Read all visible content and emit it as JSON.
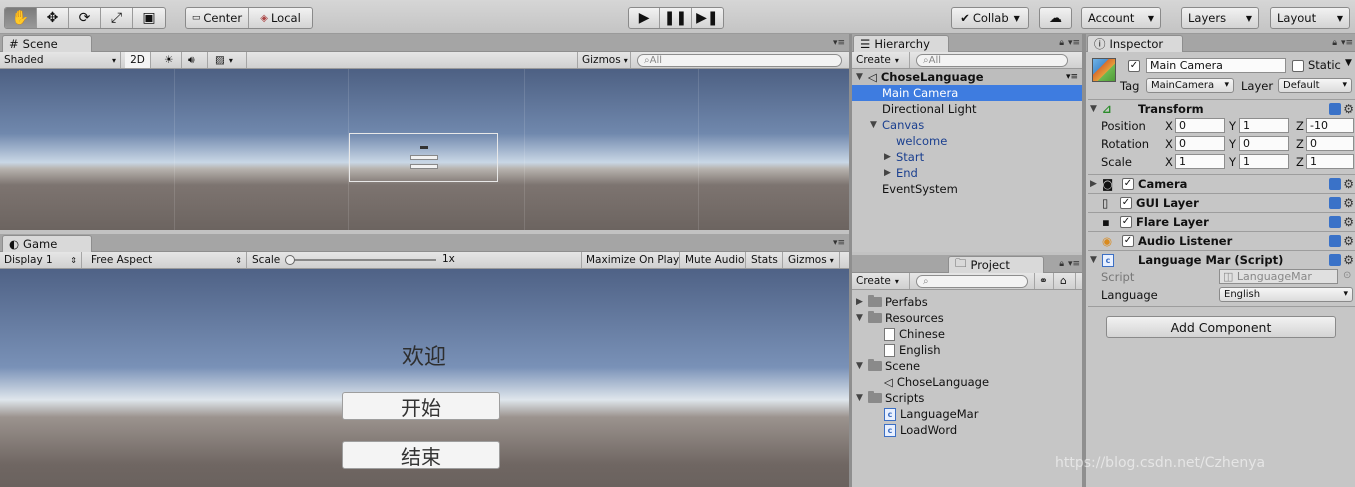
{
  "toolbar": {
    "tools": [
      "hand-icon",
      "move-icon",
      "rotate-icon",
      "scale-icon",
      "rect-icon"
    ],
    "pivot": "Center",
    "space": "Local",
    "collab": "Collab",
    "account": "Account",
    "layers": "Layers",
    "layout": "Layout"
  },
  "scene": {
    "tab": "Scene",
    "shading": "Shaded",
    "mode_2d": "2D",
    "gizmos": "Gizmos",
    "search_placeholder": "All"
  },
  "game": {
    "tab": "Game",
    "display": "Display 1",
    "aspect": "Free Aspect",
    "scale_label": "Scale",
    "scale_value": "1x",
    "maximize": "Maximize On Play",
    "mute": "Mute Audio",
    "stats": "Stats",
    "gizmos": "Gizmos",
    "welcome": "欢迎",
    "start": "开始",
    "end": "结束"
  },
  "hierarchy": {
    "tab": "Hierarchy",
    "create": "Create",
    "search_placeholder": "All",
    "scene_name": "ChoseLanguage",
    "items": [
      "Main Camera",
      "Directional Light",
      "Canvas",
      "welcome",
      "Start",
      "End",
      "EventSystem"
    ]
  },
  "project": {
    "tab": "Project",
    "create": "Create",
    "items": [
      "Perfabs",
      "Resources",
      "Chinese",
      "English",
      "Scene",
      "ChoseLanguage",
      "Scripts",
      "LanguageMar",
      "LoadWord"
    ]
  },
  "inspector": {
    "tab": "Inspector",
    "object_name": "Main Camera",
    "static_label": "Static",
    "tag_label": "Tag",
    "tag_value": "MainCamera",
    "layer_label": "Layer",
    "layer_value": "Default",
    "transform": {
      "title": "Transform",
      "position_label": "Position",
      "position": [
        "0",
        "1",
        "-10"
      ],
      "rotation_label": "Rotation",
      "rotation": [
        "0",
        "0",
        "0"
      ],
      "scale_label": "Scale",
      "scale": [
        "1",
        "1",
        "1"
      ],
      "axes": [
        "X",
        "Y",
        "Z"
      ]
    },
    "components": [
      "Camera",
      "GUI Layer",
      "Flare Layer",
      "Audio Listener"
    ],
    "script_component": {
      "title": "Language Mar (Script)",
      "script_label": "Script",
      "script_value": "LanguageMar",
      "language_label": "Language",
      "language_value": "English"
    },
    "add_component": "Add Component"
  },
  "watermark": "https://blog.csdn.net/Czhenya"
}
